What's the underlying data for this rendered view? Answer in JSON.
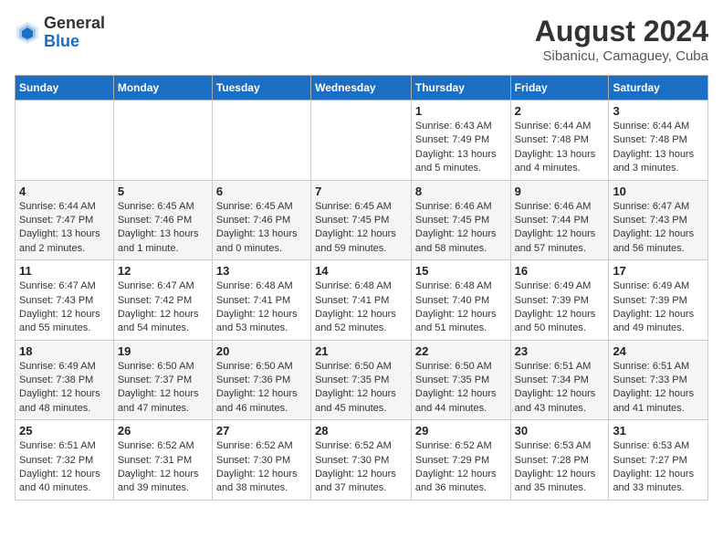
{
  "header": {
    "logo_general": "General",
    "logo_blue": "Blue",
    "month_year": "August 2024",
    "location": "Sibanicu, Camaguey, Cuba"
  },
  "days_of_week": [
    "Sunday",
    "Monday",
    "Tuesday",
    "Wednesday",
    "Thursday",
    "Friday",
    "Saturday"
  ],
  "weeks": [
    [
      {
        "day": "",
        "info": ""
      },
      {
        "day": "",
        "info": ""
      },
      {
        "day": "",
        "info": ""
      },
      {
        "day": "",
        "info": ""
      },
      {
        "day": "1",
        "info": "Sunrise: 6:43 AM\nSunset: 7:49 PM\nDaylight: 13 hours and 5 minutes."
      },
      {
        "day": "2",
        "info": "Sunrise: 6:44 AM\nSunset: 7:48 PM\nDaylight: 13 hours and 4 minutes."
      },
      {
        "day": "3",
        "info": "Sunrise: 6:44 AM\nSunset: 7:48 PM\nDaylight: 13 hours and 3 minutes."
      }
    ],
    [
      {
        "day": "4",
        "info": "Sunrise: 6:44 AM\nSunset: 7:47 PM\nDaylight: 13 hours and 2 minutes."
      },
      {
        "day": "5",
        "info": "Sunrise: 6:45 AM\nSunset: 7:46 PM\nDaylight: 13 hours and 1 minute."
      },
      {
        "day": "6",
        "info": "Sunrise: 6:45 AM\nSunset: 7:46 PM\nDaylight: 13 hours and 0 minutes."
      },
      {
        "day": "7",
        "info": "Sunrise: 6:45 AM\nSunset: 7:45 PM\nDaylight: 12 hours and 59 minutes."
      },
      {
        "day": "8",
        "info": "Sunrise: 6:46 AM\nSunset: 7:45 PM\nDaylight: 12 hours and 58 minutes."
      },
      {
        "day": "9",
        "info": "Sunrise: 6:46 AM\nSunset: 7:44 PM\nDaylight: 12 hours and 57 minutes."
      },
      {
        "day": "10",
        "info": "Sunrise: 6:47 AM\nSunset: 7:43 PM\nDaylight: 12 hours and 56 minutes."
      }
    ],
    [
      {
        "day": "11",
        "info": "Sunrise: 6:47 AM\nSunset: 7:43 PM\nDaylight: 12 hours and 55 minutes."
      },
      {
        "day": "12",
        "info": "Sunrise: 6:47 AM\nSunset: 7:42 PM\nDaylight: 12 hours and 54 minutes."
      },
      {
        "day": "13",
        "info": "Sunrise: 6:48 AM\nSunset: 7:41 PM\nDaylight: 12 hours and 53 minutes."
      },
      {
        "day": "14",
        "info": "Sunrise: 6:48 AM\nSunset: 7:41 PM\nDaylight: 12 hours and 52 minutes."
      },
      {
        "day": "15",
        "info": "Sunrise: 6:48 AM\nSunset: 7:40 PM\nDaylight: 12 hours and 51 minutes."
      },
      {
        "day": "16",
        "info": "Sunrise: 6:49 AM\nSunset: 7:39 PM\nDaylight: 12 hours and 50 minutes."
      },
      {
        "day": "17",
        "info": "Sunrise: 6:49 AM\nSunset: 7:39 PM\nDaylight: 12 hours and 49 minutes."
      }
    ],
    [
      {
        "day": "18",
        "info": "Sunrise: 6:49 AM\nSunset: 7:38 PM\nDaylight: 12 hours and 48 minutes."
      },
      {
        "day": "19",
        "info": "Sunrise: 6:50 AM\nSunset: 7:37 PM\nDaylight: 12 hours and 47 minutes."
      },
      {
        "day": "20",
        "info": "Sunrise: 6:50 AM\nSunset: 7:36 PM\nDaylight: 12 hours and 46 minutes."
      },
      {
        "day": "21",
        "info": "Sunrise: 6:50 AM\nSunset: 7:35 PM\nDaylight: 12 hours and 45 minutes."
      },
      {
        "day": "22",
        "info": "Sunrise: 6:50 AM\nSunset: 7:35 PM\nDaylight: 12 hours and 44 minutes."
      },
      {
        "day": "23",
        "info": "Sunrise: 6:51 AM\nSunset: 7:34 PM\nDaylight: 12 hours and 43 minutes."
      },
      {
        "day": "24",
        "info": "Sunrise: 6:51 AM\nSunset: 7:33 PM\nDaylight: 12 hours and 41 minutes."
      }
    ],
    [
      {
        "day": "25",
        "info": "Sunrise: 6:51 AM\nSunset: 7:32 PM\nDaylight: 12 hours and 40 minutes."
      },
      {
        "day": "26",
        "info": "Sunrise: 6:52 AM\nSunset: 7:31 PM\nDaylight: 12 hours and 39 minutes."
      },
      {
        "day": "27",
        "info": "Sunrise: 6:52 AM\nSunset: 7:30 PM\nDaylight: 12 hours and 38 minutes."
      },
      {
        "day": "28",
        "info": "Sunrise: 6:52 AM\nSunset: 7:30 PM\nDaylight: 12 hours and 37 minutes."
      },
      {
        "day": "29",
        "info": "Sunrise: 6:52 AM\nSunset: 7:29 PM\nDaylight: 12 hours and 36 minutes."
      },
      {
        "day": "30",
        "info": "Sunrise: 6:53 AM\nSunset: 7:28 PM\nDaylight: 12 hours and 35 minutes."
      },
      {
        "day": "31",
        "info": "Sunrise: 6:53 AM\nSunset: 7:27 PM\nDaylight: 12 hours and 33 minutes."
      }
    ]
  ]
}
